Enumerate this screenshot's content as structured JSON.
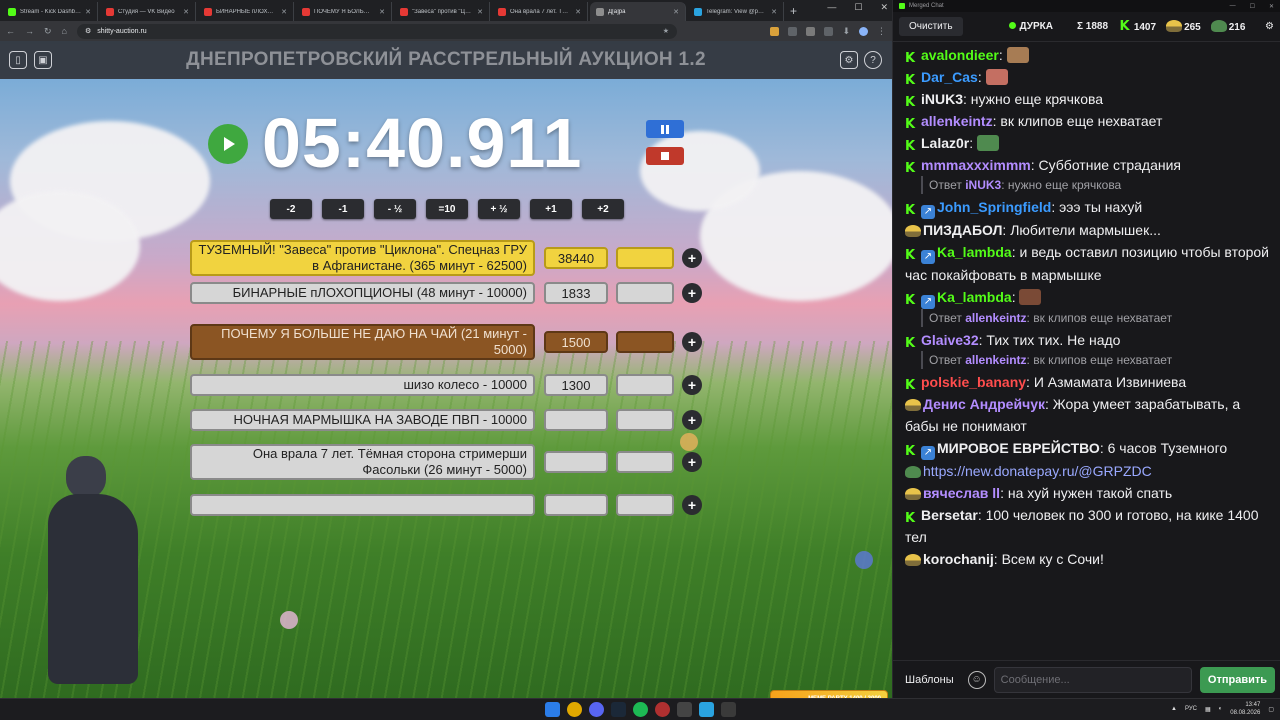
{
  "browser": {
    "tabs": [
      {
        "title": "Stream - Kick Dashboard",
        "color": "#53fc18"
      },
      {
        "title": "Студия — VK Видео",
        "color": "#e53935"
      },
      {
        "title": "БИНАРНЫЕ пЛОХОП...",
        "color": "#e53935"
      },
      {
        "title": "ПОЧЕМУ Я БОЛЬШЕ...",
        "color": "#e53935"
      },
      {
        "title": "\"Завеса\" против \"Ци...",
        "color": "#e53935"
      },
      {
        "title": "Она врала 7 лет. Тём...",
        "color": "#e53935"
      },
      {
        "title": "Д[а]ра",
        "color": "#8e8e8e"
      },
      {
        "title": "Telegram: View @pod...",
        "color": "#2aa3e0"
      }
    ],
    "url": "shitty-auction.ru"
  },
  "auction": {
    "title": "ДНЕПРОПЕТРОВСКИЙ РАССТРЕЛЬНЫЙ АУКЦИОН 1.2",
    "timer": "05:40.911",
    "steps": [
      "-2",
      "-1",
      "- ½",
      "=10",
      "+ ½",
      "+1",
      "+2"
    ],
    "lots": [
      {
        "name": "ТУЗЕМНЫЙ! \"Завеса\" против \"Циклона\". Спецназ ГРУ в Афганистане. (365 минут - 62500)",
        "amount": "38440",
        "style": "gold"
      },
      {
        "name": "БИНАРНЫЕ пЛОХОПЦИОНЫ (48 минут - 10000)",
        "amount": "1833",
        "style": "grey"
      },
      {
        "name": "ПОЧЕМУ Я БОЛЬШЕ НЕ ДАЮ НА ЧАЙ (21 минут - 5000)",
        "amount": "1500",
        "style": "brown"
      },
      {
        "name": "шизо колесо - 10000",
        "amount": "1300",
        "style": "grey"
      },
      {
        "name": "НОЧНАЯ МАРМЫШКА НА ЗАВОДЕ ПВП - 10000",
        "amount": "",
        "style": "grey"
      },
      {
        "name": "Она врала 7 лет. Тёмная сторона стримерши Фасольки (26 минут - 5000)",
        "amount": "",
        "style": "grey"
      },
      {
        "name": "",
        "amount": "",
        "style": "grey"
      }
    ]
  },
  "chat": {
    "window_title": "Merged Chat",
    "clear_label": "Очистить",
    "channel": "ДУРКА",
    "total": "Σ 1888",
    "kick_count": "1407",
    "other_count": "265",
    "third_count": "216",
    "messages": [
      {
        "user": "avalondieer",
        "color": "#53fc18",
        "text": "",
        "emote": "#a77c54",
        "badge": "k"
      },
      {
        "user": "Dar_Cas",
        "color": "#3b9bff",
        "text": "",
        "emote": "#c46f62",
        "badge": "k"
      },
      {
        "user": "iNUK3",
        "color": "#efeff1",
        "text": "нужно еще крячкова",
        "badge": "k"
      },
      {
        "user": "allenkeintz",
        "color": "#b38dff",
        "text": "вк клипов еще нехватает",
        "badge": "k"
      },
      {
        "user": "Lalaz0r",
        "color": "#efeff1",
        "text": "",
        "emote": "#4f8a4f",
        "badge": "k"
      },
      {
        "user": "mmmaxxximmm",
        "color": "#b38dff",
        "text": "Субботние страдания",
        "badge": "k",
        "reply_user": "iNUK3",
        "reply_text": "нужно еще крячкова"
      },
      {
        "user": "John_Springfield",
        "color": "#3b9bff",
        "text": "эээ ты нахуй",
        "badge": "k+sub"
      },
      {
        "user": "ПИЗДАБОЛ",
        "color": "#efeff1",
        "text": "Любители мармышек...",
        "badge": "hat"
      },
      {
        "user": "Ka_lambda",
        "color": "#53fc18",
        "text": "и ведь оставил позицию чтобы второй час покайфовать в мармышке",
        "badge": "k+sub"
      },
      {
        "user": "Ka_lambda",
        "color": "#53fc18",
        "text": "",
        "emote": "#7a4a36",
        "badge": "k+sub",
        "reply_user": "allenkeintz",
        "reply_text": "вк клипов еще нехватает"
      },
      {
        "user": "Glaive32",
        "color": "#b38dff",
        "text": "Тих тих тих. Не надо",
        "badge": "k",
        "reply_user": "allenkeintz",
        "reply_text": "вк клипов еще нехватает"
      },
      {
        "user": "polskie_banany",
        "color": "#ff4d4d",
        "text": "И Азмамата Извиниева",
        "badge": "k"
      },
      {
        "user": "Денис Андрейчук",
        "color": "#b38dff",
        "text": "Жора умеет зарабатывать, а бабы не понимают",
        "badge": "hat"
      },
      {
        "user": "МИРОВОЕ ЕВРЕЙСТВО",
        "color": "#efeff1",
        "text": "6 часов Туземного",
        "link": "https://new.donatepay.ru/@GRPZDC",
        "badge": "k+sub"
      },
      {
        "user": "вячеслав ll",
        "color": "#b38dff",
        "text": "на хуй нужен такой спать",
        "badge": "hat"
      },
      {
        "user": "Bersetar",
        "color": "#efeff1",
        "text": "100 человек по 300 и готово, на кике 1400 тел",
        "badge": "k"
      },
      {
        "user": "korochanij",
        "color": "#efeff1",
        "text": "Всем ку с Сочи!",
        "badge": "hat"
      }
    ],
    "templates_label": "Шаблоны",
    "input_placeholder": "Сообщение...",
    "send_label": "Отправить"
  },
  "taskbar": {
    "lang": "РУС",
    "time": "13:47",
    "date": "08.08.2026",
    "meme_party": "MEME PARTY",
    "meme_party_progress": "1400 / 2000"
  }
}
